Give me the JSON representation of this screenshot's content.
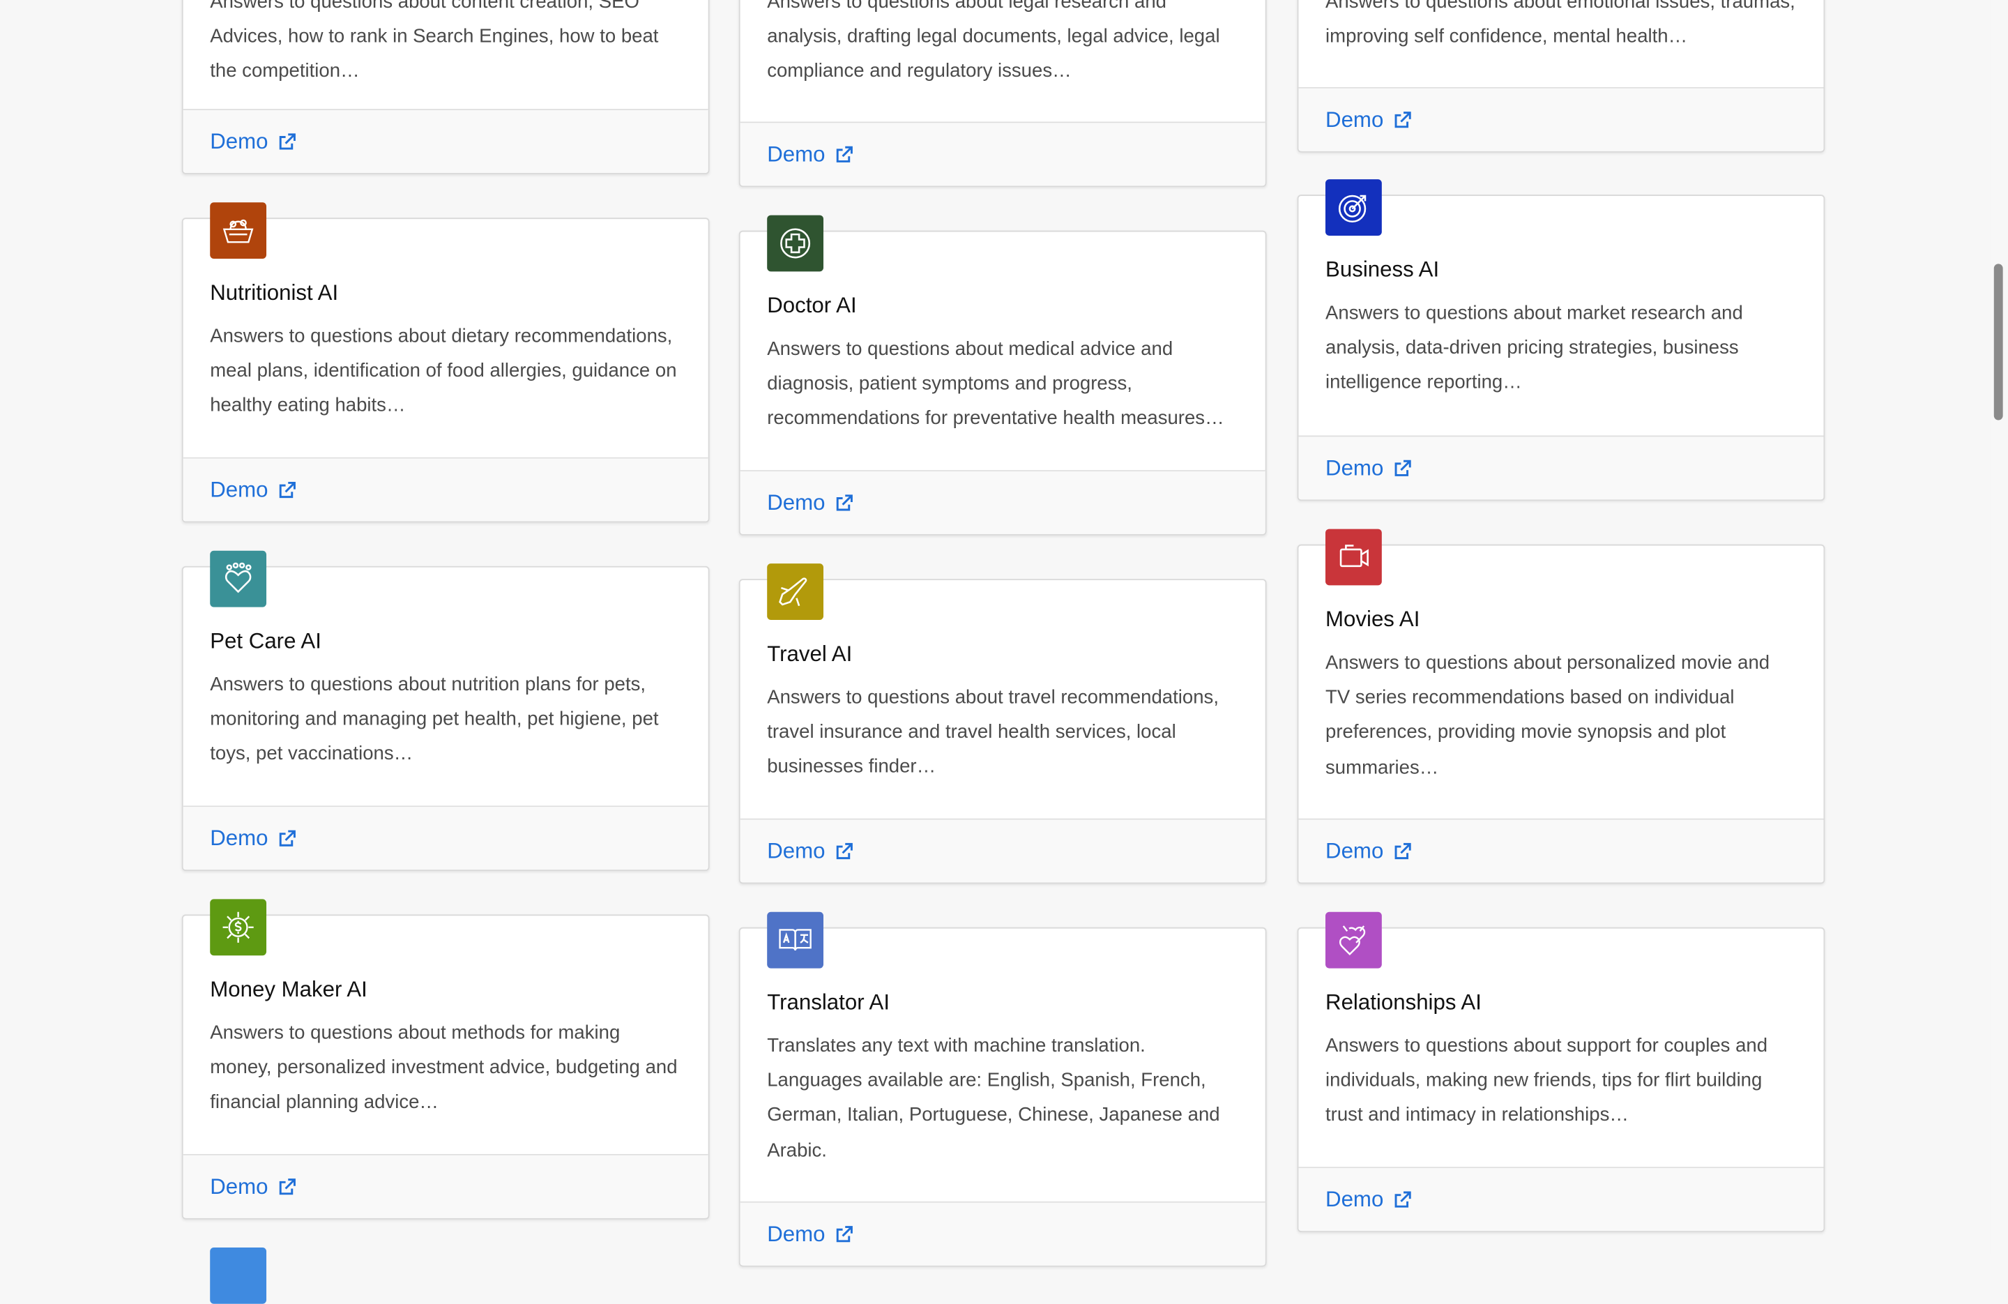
{
  "demo_label": "Demo",
  "cards": [
    {
      "key": "seo",
      "title": "",
      "desc": "Answers to questions about content creation, SEO Advices, how to rank in Search Engines, how to beat the competition…",
      "color": ""
    },
    {
      "key": "lawyer",
      "title": "",
      "desc": "Answers to questions about legal research and analysis, drafting legal documents, legal advice, legal compliance and regulatory issues…",
      "color": ""
    },
    {
      "key": "psychologist",
      "title": "",
      "desc": "Answers to questions about emotional issues, traumas, improving self confidence, mental health…",
      "color": ""
    },
    {
      "key": "nutritionist",
      "title": "Nutritionist AI",
      "desc": "Answers to questions about dietary recommendations, meal plans, identification of food allergies, guidance on healthy eating habits…",
      "color": "#b0440c",
      "icon": "food-basket-icon"
    },
    {
      "key": "doctor",
      "title": "Doctor AI",
      "desc": "Answers to questions about medical advice and diagnosis, patient symptoms and progress, recommendations for preventative health measures…",
      "color": "#2f5430",
      "icon": "medical-cross-icon"
    },
    {
      "key": "business",
      "title": "Business AI",
      "desc": "Answers to questions about market research and analysis, data-driven pricing strategies, business intelligence reporting…",
      "color": "#1330bd",
      "icon": "target-icon"
    },
    {
      "key": "petcare",
      "title": "Pet Care AI",
      "desc": "Answers to questions about nutrition plans for pets, monitoring and managing pet health, pet higiene, pet toys, pet vaccinations…",
      "color": "#3a9197",
      "icon": "paw-heart-icon"
    },
    {
      "key": "travel",
      "title": "Travel AI",
      "desc": "Answers to questions about travel recommendations, travel insurance and travel health services, local businesses finder…",
      "color": "#b29a0b",
      "icon": "airplane-icon"
    },
    {
      "key": "movies",
      "title": "Movies AI",
      "desc": "Answers to questions about personalized movie and TV series recommendations based on individual preferences, providing movie synopsis and plot summaries…",
      "color": "#c9353a",
      "icon": "video-camera-icon"
    },
    {
      "key": "moneymaker",
      "title": "Money Maker AI",
      "desc": "Answers to questions about methods for making money, personalized investment advice, budgeting and financial planning advice…",
      "color": "#5e9a12",
      "icon": "money-gear-icon"
    },
    {
      "key": "translator",
      "title": "Translator AI",
      "desc": "Translates any text with machine translation. Languages available are: English, Spanish, French, German, Italian, Portuguese, Chinese, Japanese and Arabic.",
      "color": "#4f73c7",
      "icon": "translate-book-icon"
    },
    {
      "key": "relationships",
      "title": "Relationships AI",
      "desc": "Answers to questions about support for couples and individuals, making new friends, tips for flirt building trust and intimacy in relationships…",
      "color": "#b04fc4",
      "icon": "hearts-icon"
    }
  ],
  "partial_icon_color": "#3f8ae0"
}
